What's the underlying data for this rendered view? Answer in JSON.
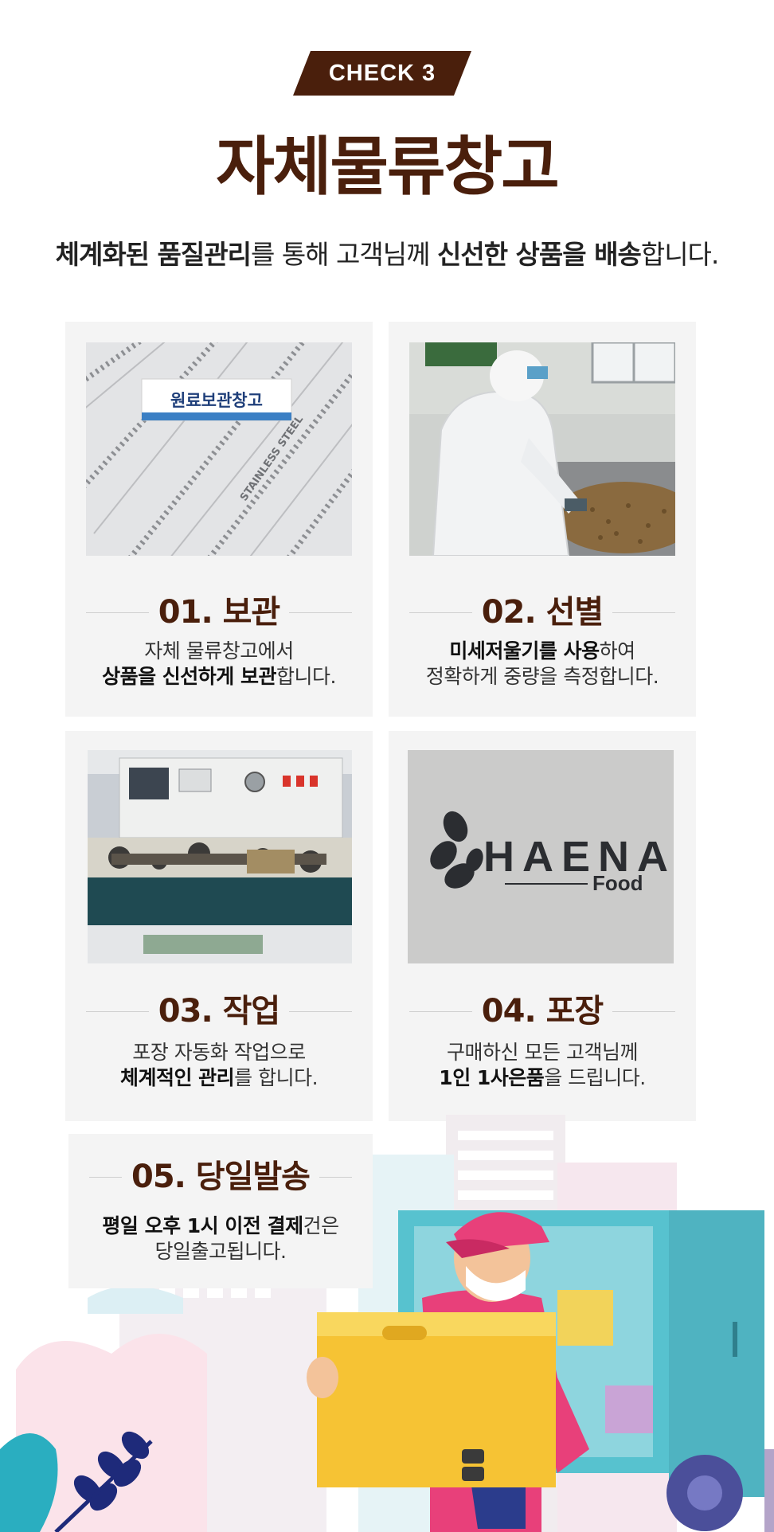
{
  "badge": "CHECK 3",
  "title": "자체물류창고",
  "subtitle": {
    "s1": "체계화된 품질관리",
    "s2": "를 통해 고객님께 ",
    "s3": "신선한 상품을 배송",
    "s4": "합니다."
  },
  "cards": [
    {
      "photo_sign": "원료보관창고",
      "photo_text": "STAINLESS STEEL",
      "title": "01. 보관",
      "l1a": "자체 물류창고에서",
      "l2a": "상품을 신선하게 보관",
      "l2b": "합니다."
    },
    {
      "title": "02. 선별",
      "l1a": "미세저울기를 사용",
      "l1b": "하여",
      "l2a": "정확하게 중량을 측정합니다."
    },
    {
      "title": "03. 작업",
      "l1a": "포장 자동화 작업으로",
      "l2a": "체계적인 관리",
      "l2b": "를 합니다."
    },
    {
      "logo_main": "HAENA",
      "logo_sub": "Food",
      "title": "04. 포장",
      "l1a": "구매하신 모든 고객님께",
      "l2a": "1인 1사은품",
      "l2b": "을 드립니다."
    },
    {
      "title": "05. 당일발송",
      "l1a": "평일 오후 1시 이전 결제",
      "l1b": "건은",
      "l2a": "당일출고됩니다."
    }
  ],
  "colors": {
    "brown": "#4a1f0c",
    "card_bg": "#f4f4f4"
  }
}
